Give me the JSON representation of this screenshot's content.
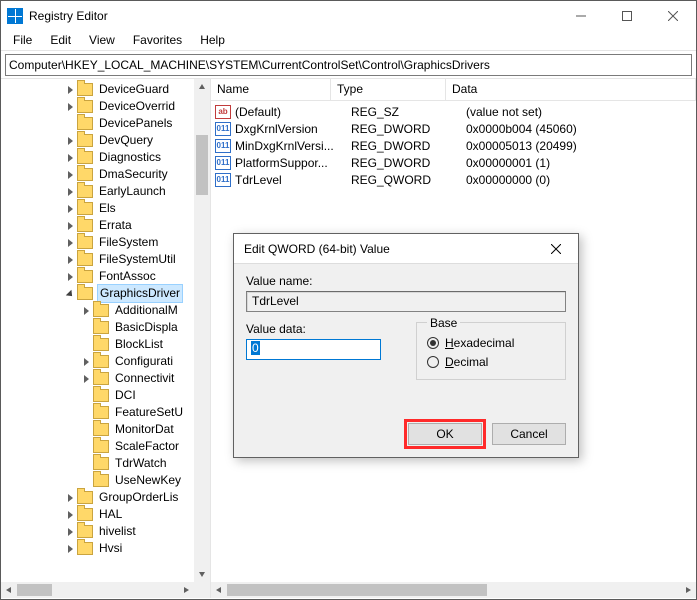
{
  "window": {
    "title": "Registry Editor"
  },
  "menu": {
    "file": "File",
    "edit": "Edit",
    "view": "View",
    "favorites": "Favorites",
    "help": "Help"
  },
  "address": "Computer\\HKEY_LOCAL_MACHINE\\SYSTEM\\CurrentControlSet\\Control\\GraphicsDrivers",
  "tree": {
    "items": [
      {
        "ind": 1,
        "arrow": "right",
        "label": "DeviceGuard"
      },
      {
        "ind": 1,
        "arrow": "right",
        "label": "DeviceOverrid"
      },
      {
        "ind": 1,
        "arrow": "none",
        "label": "DevicePanels"
      },
      {
        "ind": 1,
        "arrow": "right",
        "label": "DevQuery"
      },
      {
        "ind": 1,
        "arrow": "right",
        "label": "Diagnostics"
      },
      {
        "ind": 1,
        "arrow": "right",
        "label": "DmaSecurity"
      },
      {
        "ind": 1,
        "arrow": "right",
        "label": "EarlyLaunch"
      },
      {
        "ind": 1,
        "arrow": "right",
        "label": "Els"
      },
      {
        "ind": 1,
        "arrow": "right",
        "label": "Errata"
      },
      {
        "ind": 1,
        "arrow": "right",
        "label": "FileSystem"
      },
      {
        "ind": 1,
        "arrow": "right",
        "label": "FileSystemUtil"
      },
      {
        "ind": 1,
        "arrow": "right",
        "label": "FontAssoc"
      },
      {
        "ind": 1,
        "arrow": "down",
        "label": "GraphicsDriver",
        "selected": true
      },
      {
        "ind": 2,
        "arrow": "right",
        "label": "AdditionalM"
      },
      {
        "ind": 2,
        "arrow": "none",
        "label": "BasicDispla"
      },
      {
        "ind": 2,
        "arrow": "none",
        "label": "BlockList"
      },
      {
        "ind": 2,
        "arrow": "right",
        "label": "Configurati"
      },
      {
        "ind": 2,
        "arrow": "right",
        "label": "Connectivit"
      },
      {
        "ind": 2,
        "arrow": "none",
        "label": "DCI"
      },
      {
        "ind": 2,
        "arrow": "none",
        "label": "FeatureSetU"
      },
      {
        "ind": 2,
        "arrow": "none",
        "label": "MonitorDat"
      },
      {
        "ind": 2,
        "arrow": "none",
        "label": "ScaleFactor"
      },
      {
        "ind": 2,
        "arrow": "none",
        "label": "TdrWatch"
      },
      {
        "ind": 2,
        "arrow": "none",
        "label": "UseNewKey"
      },
      {
        "ind": 1,
        "arrow": "right",
        "label": "GroupOrderLis"
      },
      {
        "ind": 1,
        "arrow": "right",
        "label": "HAL"
      },
      {
        "ind": 1,
        "arrow": "right",
        "label": "hivelist"
      },
      {
        "ind": 1,
        "arrow": "right",
        "label": "Hvsi"
      }
    ]
  },
  "columns": {
    "name": "Name",
    "type": "Type",
    "data": "Data"
  },
  "values": [
    {
      "icon": "str",
      "name": "(Default)",
      "type": "REG_SZ",
      "data": "(value not set)"
    },
    {
      "icon": "bin",
      "name": "DxgKrnlVersion",
      "type": "REG_DWORD",
      "data": "0x0000b004 (45060)"
    },
    {
      "icon": "bin",
      "name": "MinDxgKrnlVersi...",
      "type": "REG_DWORD",
      "data": "0x00005013 (20499)"
    },
    {
      "icon": "bin",
      "name": "PlatformSuppor...",
      "type": "REG_DWORD",
      "data": "0x00000001 (1)"
    },
    {
      "icon": "bin",
      "name": "TdrLevel",
      "type": "REG_QWORD",
      "data": "0x00000000 (0)"
    }
  ],
  "dialog": {
    "title": "Edit QWORD (64-bit) Value",
    "value_name_label": "Value name:",
    "value_name": "TdrLevel",
    "value_data_label": "Value data:",
    "value_data": "0",
    "base_label": "Base",
    "hex_label": "Hexadecimal",
    "dec_label": "Decimal",
    "ok": "OK",
    "cancel": "Cancel"
  }
}
